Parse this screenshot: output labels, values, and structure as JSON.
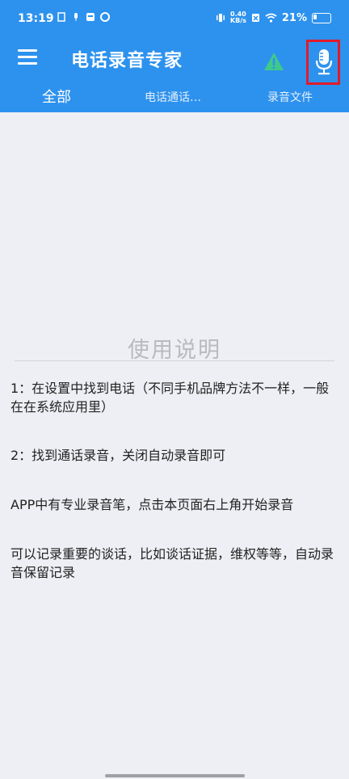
{
  "status_bar": {
    "time": "13:19",
    "speed_top": "0.40",
    "speed_bottom": "KB/s",
    "battery": "21%"
  },
  "toolbar": {
    "title": "电话录音专家",
    "menu_icon": "hamburger-menu-icon",
    "warning_icon": "warning-triangle-icon",
    "mic_icon": "microphone-icon"
  },
  "tabs": [
    {
      "label": "全部"
    },
    {
      "label": "电话通话…"
    },
    {
      "label": "录音文件"
    }
  ],
  "instructions": {
    "title": "使用说明",
    "paragraphs": [
      "1：在设置中找到电话（不同手机品牌方法不一样，一般在在系统应用里）",
      "2：找到通话录音，关闭自动录音即可",
      "APP中有专业录音笔，点击本页面右上角开始录音",
      "可以记录重要的谈话，比如谈话证据，维权等等，自动录音保留记录"
    ]
  },
  "colors": {
    "header": "#2d92ee",
    "background": "#eeeff4",
    "warning_green": "#3fc98a",
    "highlight_red": "#e11b2a"
  }
}
